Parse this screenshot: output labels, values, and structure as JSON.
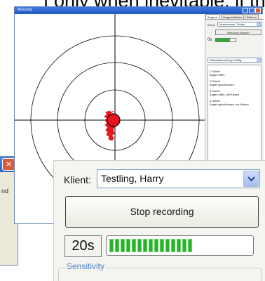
{
  "background": {
    "text": "f only when inevitable, if the"
  },
  "back_dialog": {
    "close_glyph": "×",
    "text": "nd"
  },
  "main_window": {
    "title": "Messung",
    "tabs": [
      "Beginne",
      "Vorgeschichten",
      "Bühnen"
    ],
    "client_label": "Klient:",
    "client_value": "Mustermann, Tobias",
    "stop_label": "Messung stoppen",
    "timer": "0s",
    "mode_value": "Standardmessung 4-teilig",
    "steps": [
      "1 Schritt\nAugen offen",
      "2 Schritt\nAugen geschlossen",
      "3 Schritt\nAugen offen, mit Kissen",
      "4 Schritt\nAugen geschlossen, mit Kissen"
    ]
  },
  "zoom_panel": {
    "client_label": "Klient:",
    "client_value": "Testling, Harry",
    "stop_label": "Stop recording",
    "timer": "20s",
    "progress": 0.6,
    "sensitivity_label": "Sensitivity"
  },
  "colors": {
    "title_bar": "#2d62c8",
    "progress": "#27b327",
    "sway_path": "#e8141e",
    "group_label": "#4d82c8"
  }
}
